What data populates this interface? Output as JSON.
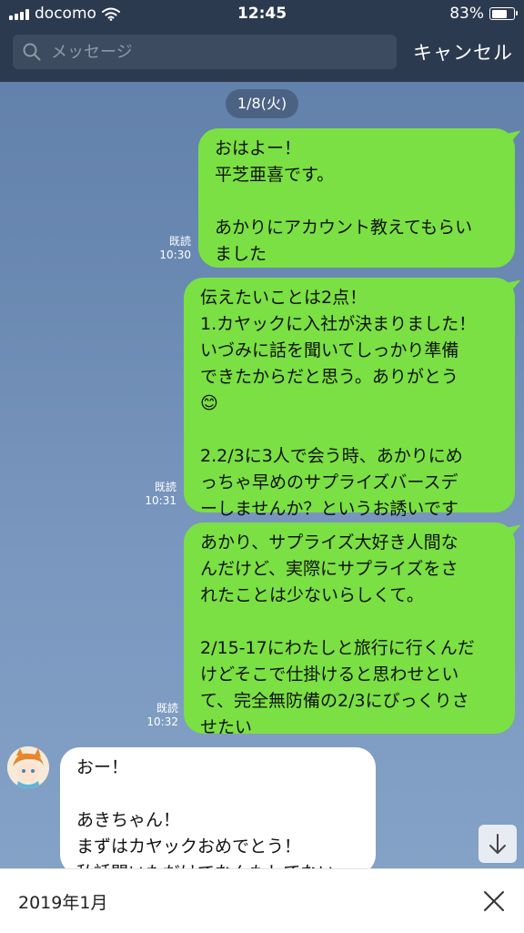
{
  "status": {
    "carrier": "docomo",
    "time": "12:45",
    "battery": "83%",
    "battery_level": 0.83
  },
  "search": {
    "placeholder": "メッセージ",
    "cancel_label": "キャンセル"
  },
  "chat": {
    "date": "1/8(火)",
    "messages": [
      {
        "text": "おはよー！\n平芝亜喜です。\n\nあかりにアカウント教えてもらい\nました",
        "read": "既読",
        "time": "10:30"
      },
      {
        "text": "伝えたいことは2点！\n1.カヤックに入社が決まりました！\nいづみに話を聞いてしっかり準備\nできたからだと思う。ありがとう\n😊\n\n2.2/3に3人で会う時、あかりにめ\nっちゃ早めのサプライズバースデ\nーしませんか？というお誘いです",
        "read": "既読",
        "time": "10:31"
      },
      {
        "text": "あかり、サプライズ大好き人間な\nんだけど、実際にサプライズをさ\nれたことは少ないらしくて。\n\n2/15-17にわたしと旅行に行くんだ\nけどそこで仕掛けると思わせとい\nて、完全無防備の2/3にびっくりさ\nせたい",
        "read": "既読",
        "time": "10:32"
      }
    ],
    "incoming": {
      "text": "おー！\n\nあきちゃん！\nまずはカヤックおめでとう！\n私話聞いただけでなんもしてない"
    }
  },
  "bottom": {
    "month": "2019年1月"
  },
  "icons": {
    "search": "search-icon",
    "wifi": "wifi-icon",
    "scroll_down": "arrow-down-icon",
    "close": "close-icon"
  },
  "colors": {
    "header": "#2c3a4f",
    "outgoing_bubble": "#7be043",
    "incoming_bubble": "#ffffff"
  }
}
